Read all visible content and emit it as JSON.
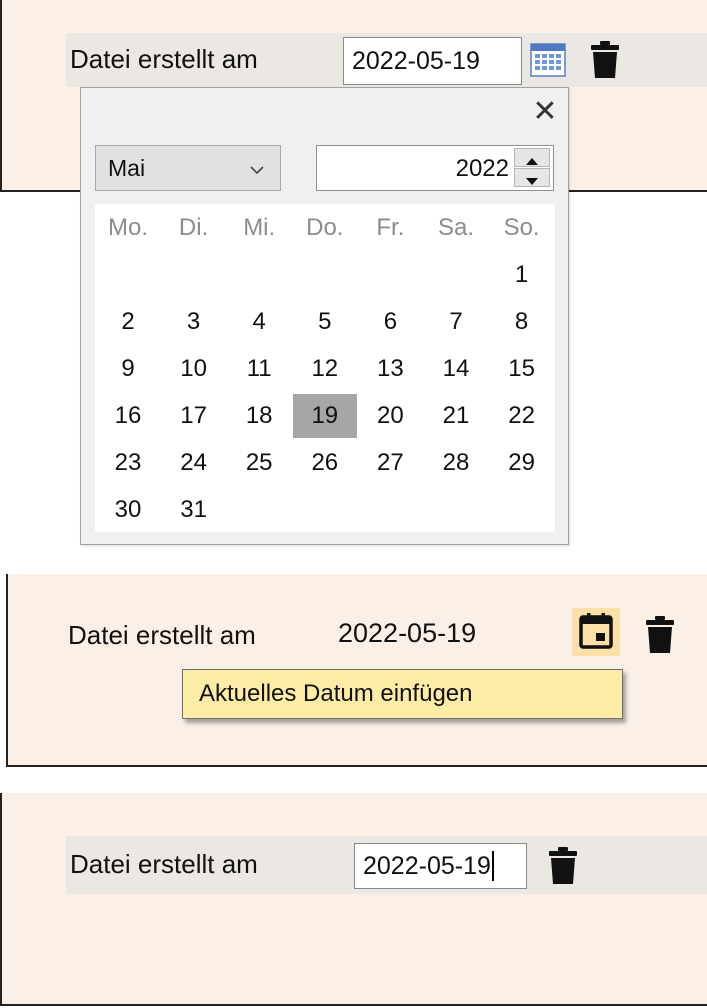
{
  "panel_top": {
    "label": "Datei erstellt am",
    "date_value": "2022-05-19"
  },
  "calendar_popup": {
    "close_symbol": "✕",
    "month": "Mai",
    "year": "2022",
    "weekdays": [
      "Mo.",
      "Di.",
      "Mi.",
      "Do.",
      "Fr.",
      "Sa.",
      "So."
    ],
    "first_weekday_index": 6,
    "days_in_month": 31,
    "selected_day": 19
  },
  "panel_middle": {
    "label": "Datei erstellt am",
    "date_value": "2022-05-19",
    "tooltip": "Aktuelles Datum einfügen",
    "icons": [
      "calendar-today-icon",
      "trash-icon"
    ]
  },
  "panel_bottom": {
    "label": "Datei erstellt am",
    "date_value": "2022-05-19"
  },
  "colors": {
    "panel_bg": "#faf0e8",
    "row_bg": "#ebe7e2",
    "selected_day": "#a6a6a6",
    "tooltip_bg": "#fdeca6",
    "today_button_bg": "#fde0a8"
  }
}
